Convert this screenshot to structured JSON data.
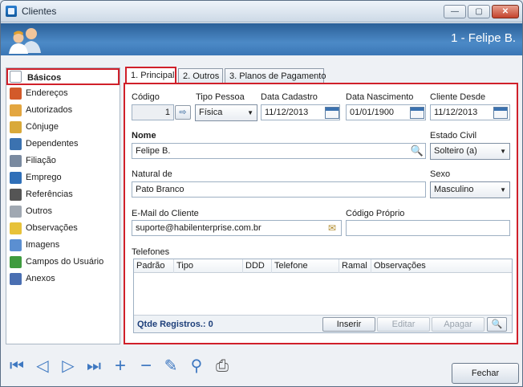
{
  "window": {
    "title": "Clientes"
  },
  "banner": {
    "title": "1 - Felipe B."
  },
  "sidebar": {
    "items": [
      {
        "label": "Básicos",
        "icon": "document-icon",
        "color": "#ffffff"
      },
      {
        "label": "Endereços",
        "icon": "house-icon",
        "color": "#d35a2a"
      },
      {
        "label": "Autorizados",
        "icon": "people-icon",
        "color": "#e3a640"
      },
      {
        "label": "Cônjuge",
        "icon": "rings-icon",
        "color": "#d9a93a"
      },
      {
        "label": "Dependentes",
        "icon": "tree-icon",
        "color": "#3b72b0"
      },
      {
        "label": "Filiação",
        "icon": "person-icon",
        "color": "#7a8aa0"
      },
      {
        "label": "Emprego",
        "icon": "cube-icon",
        "color": "#2f6fb8"
      },
      {
        "label": "Referências",
        "icon": "list-icon",
        "color": "#555555"
      },
      {
        "label": "Outros",
        "icon": "pages-icon",
        "color": "#a0a8b2"
      },
      {
        "label": "Observações",
        "icon": "note-icon",
        "color": "#e7c23a"
      },
      {
        "label": "Imagens",
        "icon": "image-icon",
        "color": "#5b8fd1"
      },
      {
        "label": "Campos do Usuário",
        "icon": "user-fields-icon",
        "color": "#3f9b3f"
      },
      {
        "label": "Anexos",
        "icon": "clip-icon",
        "color": "#4a6fb2"
      }
    ]
  },
  "tabs": [
    {
      "label": "1. Principal"
    },
    {
      "label": "2. Outros"
    },
    {
      "label": "3. Planos de Pagamento"
    }
  ],
  "form": {
    "codigo": {
      "label": "Código",
      "value": "1"
    },
    "tipo_pessoa": {
      "label": "Tipo Pessoa",
      "value": "Física"
    },
    "data_cadastro": {
      "label": "Data Cadastro",
      "value": "11/12/2013"
    },
    "data_nascimento": {
      "label": "Data Nascimento",
      "value": "01/01/1900"
    },
    "cliente_desde": {
      "label": "Cliente Desde",
      "value": "11/12/2013"
    },
    "nome": {
      "label": "Nome",
      "value": "Felipe B."
    },
    "estado_civil": {
      "label": "Estado Civil",
      "value": "Solteiro (a)"
    },
    "natural_de": {
      "label": "Natural de",
      "value": "Pato Branco"
    },
    "sexo": {
      "label": "Sexo",
      "value": "Masculino"
    },
    "email": {
      "label": "E-Mail do Cliente",
      "value": "suporte@habilenterprise.com.br"
    },
    "codigo_proprio": {
      "label": "Código Próprio",
      "value": ""
    }
  },
  "telefones": {
    "label": "Telefones",
    "columns": [
      "Padrão",
      "Tipo",
      "DDD",
      "Telefone",
      "Ramal",
      "Observações"
    ],
    "rows": [],
    "count_label": "Qtde Registros.: 0",
    "buttons": {
      "insert": "Inserir",
      "edit": "Editar",
      "delete": "Apagar"
    }
  },
  "footer": {
    "close_label": "Fechar"
  }
}
